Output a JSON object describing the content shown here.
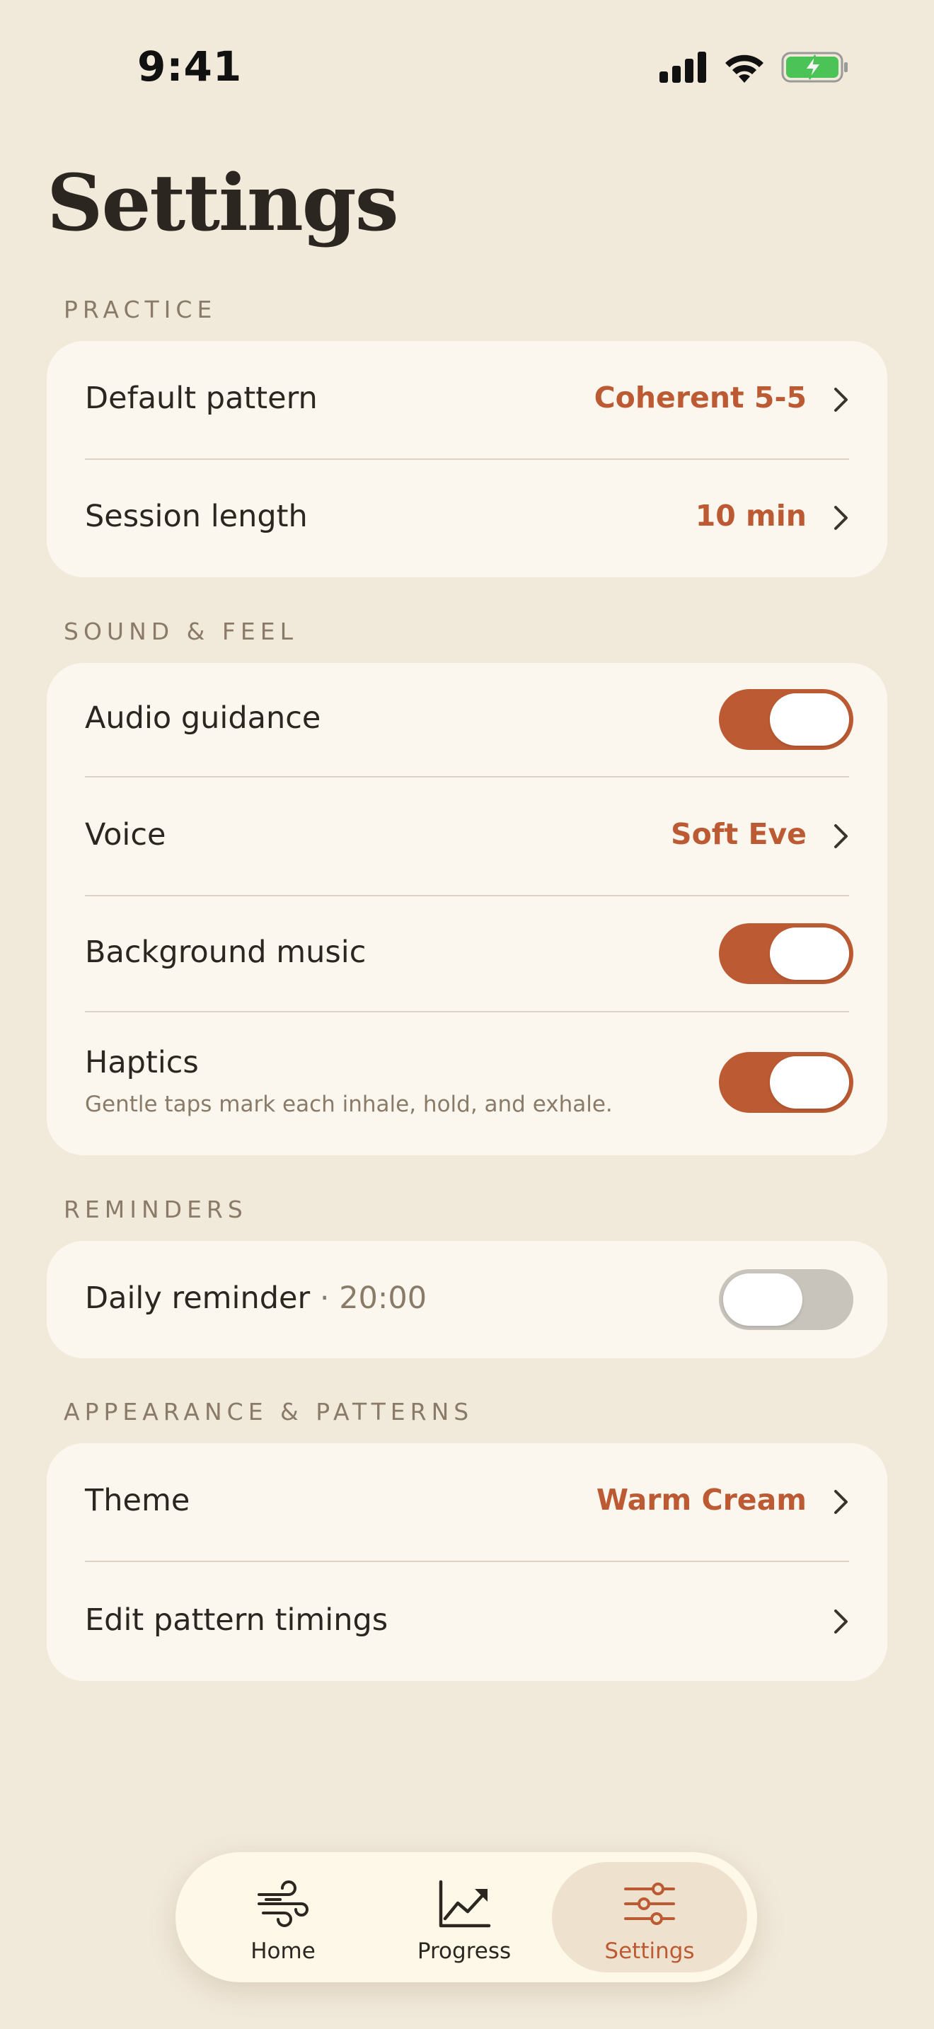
{
  "status_bar": {
    "time": "9:41"
  },
  "page": {
    "title": "Settings"
  },
  "sections": {
    "practice": {
      "label": "PRACTICE",
      "rows": {
        "default_pattern": {
          "label": "Default pattern",
          "value": "Coherent 5-5"
        },
        "session_length": {
          "label": "Session length",
          "value": "10 min"
        }
      }
    },
    "sound_feel": {
      "label": "SOUND & FEEL",
      "rows": {
        "audio_guidance": {
          "label": "Audio guidance",
          "toggle": true
        },
        "voice": {
          "label": "Voice",
          "value": "Soft Eve"
        },
        "background_music": {
          "label": "Background music",
          "toggle": true
        },
        "haptics": {
          "label": "Haptics",
          "description": "Gentle taps mark each inhale, hold, and exhale.",
          "toggle": true
        }
      }
    },
    "reminders": {
      "label": "REMINDERS",
      "rows": {
        "daily_reminder": {
          "label": "Daily reminder",
          "time": " · 20:00",
          "toggle": false
        }
      }
    },
    "appearance": {
      "label": "APPEARANCE & PATTERNS",
      "rows": {
        "theme": {
          "label": "Theme",
          "value": "Warm Cream"
        },
        "edit_timings": {
          "label": "Edit pattern timings"
        }
      }
    }
  },
  "tab_bar": {
    "tabs": [
      {
        "label": "Home",
        "icon": "wind-icon",
        "active": false
      },
      {
        "label": "Progress",
        "icon": "chart-trend-icon",
        "active": false
      },
      {
        "label": "Settings",
        "icon": "sliders-icon",
        "active": true
      }
    ]
  },
  "colors": {
    "background": "#F1E9DA",
    "card": "#FBF7EF",
    "accent": "#BC5B33",
    "muted": "#8A7B68",
    "toggle_off": "#C8C3BB"
  }
}
